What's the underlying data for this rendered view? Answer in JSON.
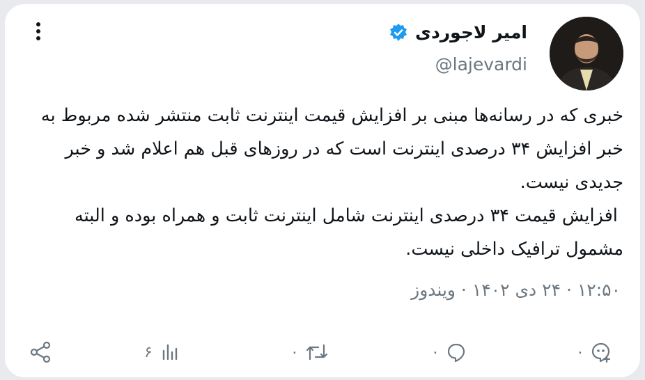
{
  "author": {
    "name": "امیر لاجوردی",
    "handle": "@lajevardi",
    "verified": true,
    "avatar_icon": "profile-photo"
  },
  "tweet": {
    "text": "خبری که در رسانه‌ها مبنی بر افزایش قیمت اینترنت ثابت منتشر شده مربوط به خبر افزایش ۳۴ درصدی اینترنت است که در روزهای قبل هم اعلام شد و خبر جدیدی نیست.\n افزایش قیمت ۳۴ درصدی اینترنت شامل اینترنت ثابت و همراه بوده و البته مشمول ترافیک داخلی نیست.",
    "meta": "۱۲:۵۰ · ۲۴ دی ۱۴۰۲ · ویندوز"
  },
  "actions": {
    "reply_count": "۰",
    "retweet_count": "۰",
    "like_count": "۰",
    "views_count": "۶"
  },
  "colors": {
    "text": "#0f1419",
    "secondary": "#6b7780",
    "verified_badge": "#1d9bf0"
  }
}
